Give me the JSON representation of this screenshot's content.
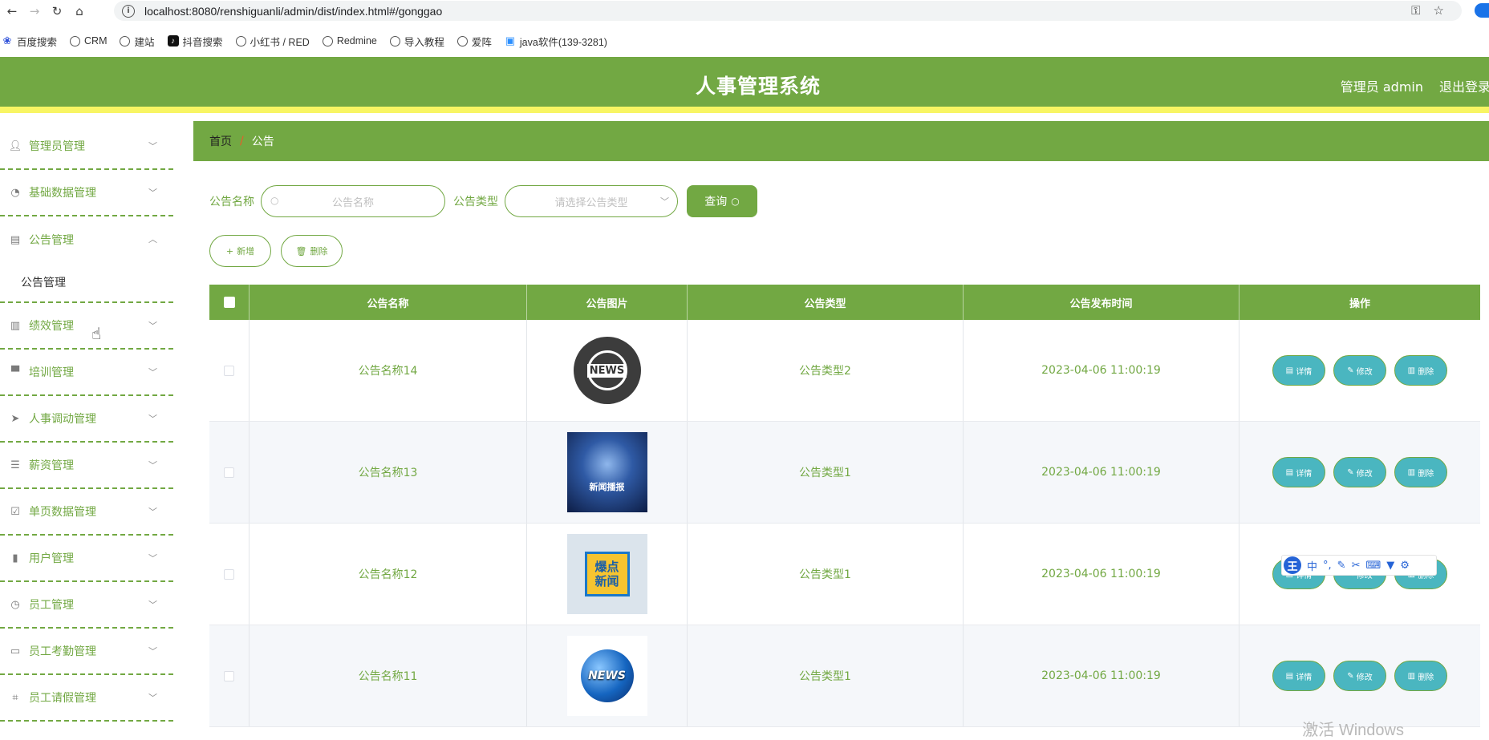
{
  "browser": {
    "url": "localhost:8080/renshiguanli/admin/dist/index.html#/gonggao",
    "bookmarks": [
      "百度搜索",
      "CRM",
      "建站",
      "抖音搜索",
      "小红书 / RED",
      "Redmine",
      "导入教程",
      "爱阵",
      "java软件(139-3281)"
    ]
  },
  "header": {
    "title": "人事管理系统",
    "user": "管理员 admin",
    "logout": "退出登录"
  },
  "sidebar": {
    "items": [
      {
        "label": "管理员管理",
        "icon": "user-icon"
      },
      {
        "label": "基础数据管理",
        "icon": "gauge-icon"
      },
      {
        "label": "公告管理",
        "icon": "clipboard-icon",
        "expanded": true,
        "sub": [
          "公告管理"
        ]
      },
      {
        "label": "绩效管理",
        "icon": "notebook-icon"
      },
      {
        "label": "培训管理",
        "icon": "brush-icon"
      },
      {
        "label": "人事调动管理",
        "icon": "send-icon"
      },
      {
        "label": "薪资管理",
        "icon": "list-icon"
      },
      {
        "label": "单页数据管理",
        "icon": "checklist-icon"
      },
      {
        "label": "用户管理",
        "icon": "bar-chart-icon"
      },
      {
        "label": "员工管理",
        "icon": "clock-icon"
      },
      {
        "label": "员工考勤管理",
        "icon": "chat-icon"
      },
      {
        "label": "员工请假管理",
        "icon": "crop-icon"
      }
    ]
  },
  "breadcrumb": {
    "home": "首页",
    "separator": "/",
    "current": "公告"
  },
  "search": {
    "name_label": "公告名称",
    "name_placeholder": "公告名称",
    "type_label": "公告类型",
    "type_placeholder": "请选择公告类型",
    "query_button": "查询"
  },
  "actions": {
    "add": "新增",
    "delete": "删除"
  },
  "table": {
    "headers": [
      "公告名称",
      "公告图片",
      "公告类型",
      "公告发布时间",
      "操作"
    ],
    "rows": [
      {
        "name": "公告名称14",
        "type": "公告类型2",
        "time": "2023-04-06 11:00:19",
        "image": "NEWS",
        "image_kind": "news-globe"
      },
      {
        "name": "公告名称13",
        "type": "公告类型1",
        "time": "2023-04-06 11:00:19",
        "image": "新闻播报",
        "image_kind": "stage"
      },
      {
        "name": "公告名称12",
        "type": "公告类型1",
        "time": "2023-04-06 11:00:19",
        "image": "爆点新闻",
        "image_kind": "burst"
      },
      {
        "name": "公告名称11",
        "type": "公告类型1",
        "time": "2023-04-06 11:00:19",
        "image": "NEWS",
        "image_kind": "blue-globe"
      }
    ],
    "ops": {
      "detail": "详情",
      "edit": "修改",
      "delete": "删除"
    }
  },
  "ime": {
    "logo": "王",
    "mode": "中"
  },
  "watermark": "激活 Windows",
  "colors": {
    "primary": "#72a843",
    "accent_strip": "#f8f563",
    "op_button": "#4ab6c0",
    "breadcrumb_sep": "#e95b29"
  }
}
